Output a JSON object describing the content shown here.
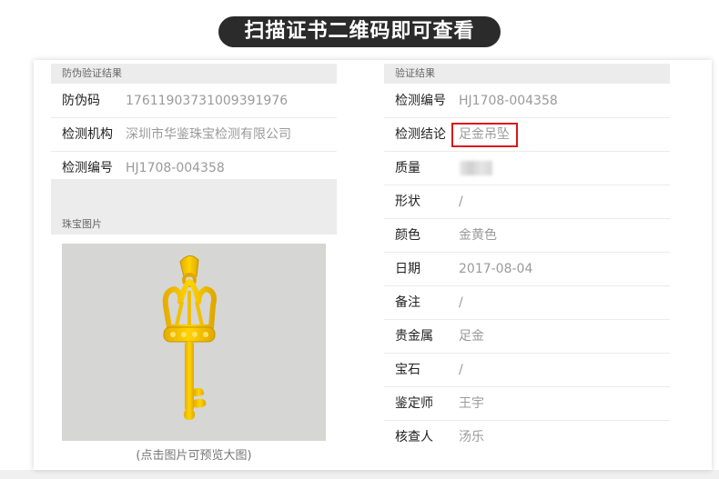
{
  "banner": {
    "text": "扫描证书二维码即可查看"
  },
  "left": {
    "header": "防伪验证结果",
    "rows": [
      {
        "label": "防伪码",
        "value": "17611903731009391976"
      },
      {
        "label": "检测机构",
        "value": "深圳市华鉴珠宝检测有限公司"
      },
      {
        "label": "检测编号",
        "value": "HJ1708-004358"
      }
    ],
    "image_header": "珠宝图片",
    "image_caption": "(点击图片可预览大图)"
  },
  "right": {
    "header": "验证结果",
    "rows": [
      {
        "label": "检测编号",
        "value": "HJ1708-004358"
      },
      {
        "label": "检测结论",
        "value": "足金吊坠"
      },
      {
        "label": "质量",
        "value": ""
      },
      {
        "label": "形状",
        "value": "/"
      },
      {
        "label": "颜色",
        "value": "金黄色"
      },
      {
        "label": "日期",
        "value": "2017-08-04"
      },
      {
        "label": "备注",
        "value": "/"
      },
      {
        "label": "贵金属",
        "value": "足金"
      },
      {
        "label": "宝石",
        "value": "/"
      },
      {
        "label": "鉴定师",
        "value": "王宇"
      },
      {
        "label": "核查人",
        "value": "汤乐"
      }
    ]
  },
  "colors": {
    "highlight_border": "#d8161c",
    "banner_bg": "#2b2b2b",
    "gold": "#f2c500"
  }
}
